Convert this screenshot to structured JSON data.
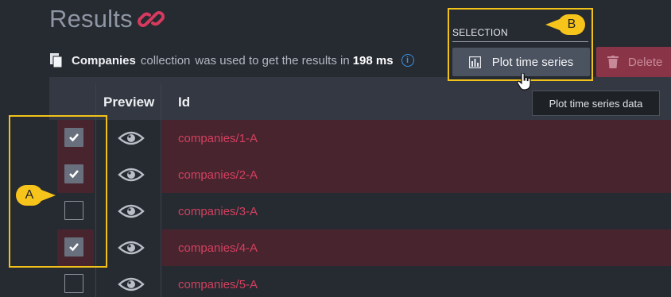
{
  "header": {
    "title": "Results"
  },
  "info": {
    "collection_name": "Companies",
    "collection_text": "collection",
    "used_text": "was used to get the results in",
    "duration": "198 ms"
  },
  "selection": {
    "label": "SELECTION",
    "plot_button": "Plot time series",
    "delete_button": "Delete",
    "tooltip": "Plot time series data"
  },
  "callouts": {
    "a": "A",
    "b": "B"
  },
  "table": {
    "columns": [
      "Preview",
      "Id"
    ],
    "rows": [
      {
        "id": "companies/1-A",
        "checked": true
      },
      {
        "id": "companies/2-A",
        "checked": true
      },
      {
        "id": "companies/3-A",
        "checked": false
      },
      {
        "id": "companies/4-A",
        "checked": true
      },
      {
        "id": "companies/5-A",
        "checked": false
      }
    ]
  },
  "colors": {
    "accent": "#f2c21b",
    "id_link": "#d3405e",
    "selected_row": "#48242f",
    "background": "#262a31"
  },
  "icons": {
    "title": "link-icon",
    "collection": "document-icon",
    "info": "info-icon",
    "plot": "bar-chart-icon",
    "delete": "trash-icon",
    "preview": "eye-icon",
    "check": "checkmark-icon"
  }
}
